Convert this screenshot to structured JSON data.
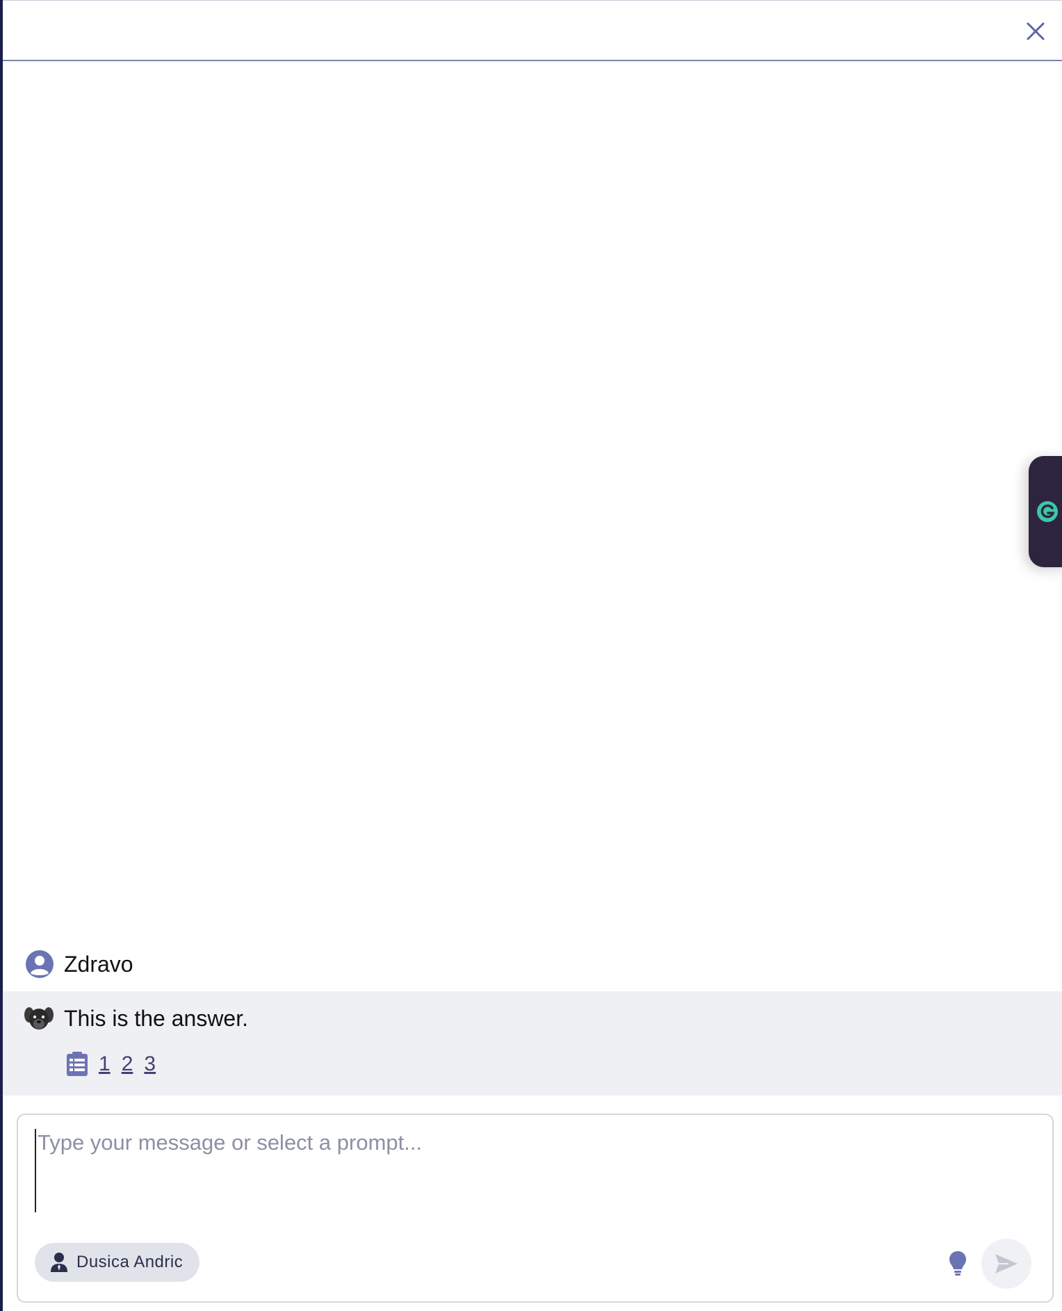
{
  "header": {
    "close_icon": "close-icon"
  },
  "messages": [
    {
      "role": "user",
      "avatar_icon": "user-circle-icon",
      "text": "Zdravo"
    },
    {
      "role": "assistant",
      "avatar_icon": "dog-avatar-icon",
      "text": "This is the answer.",
      "sources_icon": "document-list-icon",
      "sources": [
        "1",
        "2",
        "3"
      ]
    }
  ],
  "composer": {
    "placeholder": "Type your message or select a prompt...",
    "value": "",
    "persona": {
      "icon": "user-tie-icon",
      "label": "Dusica Andric"
    },
    "bulb_icon": "lightbulb-icon",
    "send_icon": "send-icon"
  },
  "grammarly": {
    "icon": "grammarly-icon"
  },
  "colors": {
    "accent": "#6c73b3",
    "sidebar_border": "#1b1f4a",
    "bot_bg": "#eff0f4",
    "grammarly_bg": "#2d2540",
    "grammarly_icon": "#3ec6a8"
  }
}
